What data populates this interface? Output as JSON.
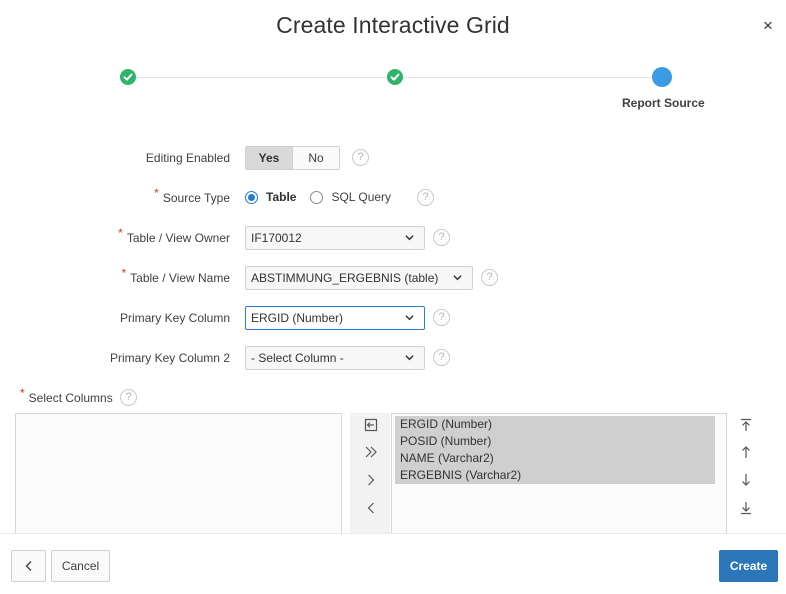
{
  "dialog": {
    "title": "Create Interactive Grid",
    "close_icon": "×"
  },
  "wizard": {
    "steps": [
      {
        "status": "complete",
        "icon": "check-icon"
      },
      {
        "status": "complete",
        "icon": "check-icon"
      },
      {
        "status": "current",
        "label": "Report Source"
      }
    ],
    "colors": {
      "complete": "#2eb46b",
      "current": "#3c9be4"
    }
  },
  "form": {
    "editing_enabled": {
      "label": "Editing Enabled",
      "options": [
        "Yes",
        "No"
      ],
      "selected": "Yes"
    },
    "source_type": {
      "label": "Source Type",
      "required": true,
      "options": [
        "Table",
        "SQL Query"
      ],
      "selected": "Table"
    },
    "table_owner": {
      "label": "Table / View Owner",
      "required": true,
      "value": "IF170012"
    },
    "table_name": {
      "label": "Table / View Name",
      "required": true,
      "value": "ABSTIMMUNG_ERGEBNIS (table)"
    },
    "pk_column": {
      "label": "Primary Key Column",
      "value": "ERGID (Number)"
    },
    "pk_column_2": {
      "label": "Primary Key Column 2",
      "value": "- Select Column -"
    },
    "select_columns": {
      "label": "Select Columns",
      "required": true
    },
    "required_marker": "*",
    "help_glyph": "?"
  },
  "shuttle": {
    "available": [],
    "selected": [
      "ERGID (Number)",
      "POSID (Number)",
      "NAME (Varchar2)",
      "ERGEBNIS (Varchar2)"
    ]
  },
  "footer": {
    "back_icon": "chevron-left-icon",
    "cancel_label": "Cancel",
    "create_label": "Create"
  },
  "colors": {
    "primary": "#2a76b8",
    "required": "#e0322d",
    "focus": "#2b7fd6"
  }
}
